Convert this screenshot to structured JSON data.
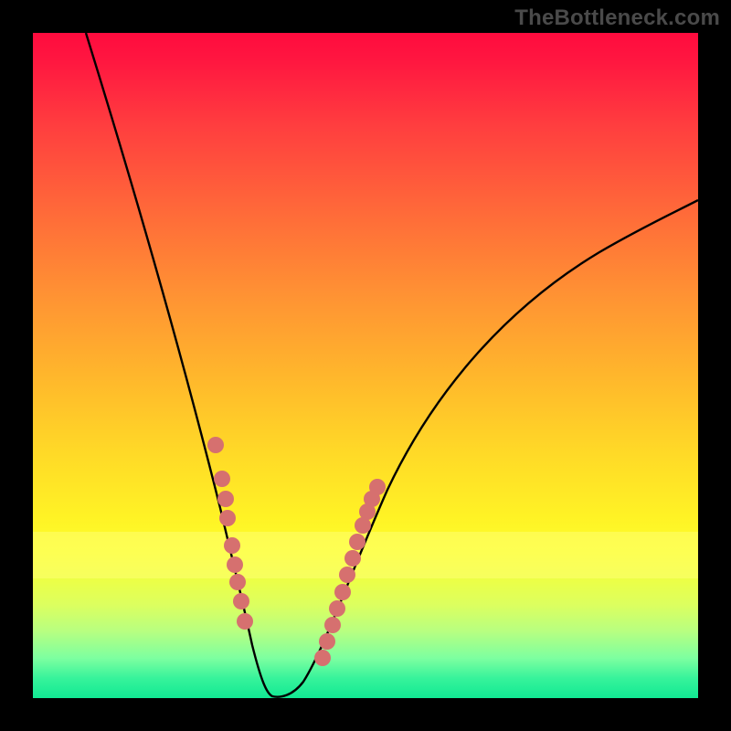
{
  "watermark": "TheBottleneck.com",
  "colors": {
    "curve_stroke": "#000000",
    "dot_fill": "#d6706f",
    "background": "#000000"
  },
  "chart_data": {
    "type": "line",
    "title": "",
    "xlabel": "",
    "ylabel": "",
    "xlim": [
      0,
      100
    ],
    "ylim": [
      0,
      100
    ],
    "grid": false,
    "series": [
      {
        "name": "curve",
        "x": [
          8,
          12,
          16,
          20,
          24,
          26,
          28,
          30,
          31,
          32,
          33,
          34,
          35,
          36,
          38,
          40,
          42,
          44,
          46,
          48,
          52,
          56,
          60,
          66,
          74,
          82,
          90,
          100
        ],
        "y": [
          100,
          88,
          76,
          64,
          50,
          42,
          34,
          24,
          18,
          12,
          7,
          3,
          0.5,
          0,
          0,
          0.5,
          3,
          8,
          14,
          20,
          30,
          38,
          44,
          52,
          60,
          66,
          71,
          76
        ],
        "note": "Approximate V-shaped bottleneck curve; y=0 near x≈36. Values estimated from pixel positions (no axis ticks present)."
      }
    ],
    "threshold_band": {
      "y_from": 18,
      "y_to": 25,
      "note": "pale yellow band"
    },
    "dots": {
      "name": "highlight-dots",
      "color": "#d6706f",
      "points_xy": [
        [
          27.5,
          38
        ],
        [
          28.5,
          33
        ],
        [
          29,
          30
        ],
        [
          29.3,
          27
        ],
        [
          30,
          23
        ],
        [
          30.4,
          20
        ],
        [
          30.8,
          17.5
        ],
        [
          31.3,
          14.5
        ],
        [
          31.8,
          11.5
        ],
        [
          43.5,
          6
        ],
        [
          44.2,
          8.5
        ],
        [
          45,
          11
        ],
        [
          45.8,
          13.5
        ],
        [
          46.5,
          16
        ],
        [
          47.3,
          18.5
        ],
        [
          48,
          21
        ],
        [
          48.8,
          23.5
        ],
        [
          49.6,
          26
        ],
        [
          50.3,
          28
        ],
        [
          51,
          30
        ],
        [
          51.8,
          31.8
        ]
      ],
      "note": "Two clusters of fat dots overlaying the curve on the descending and ascending flanks near the trough. Coordinates are in x%,y% of the plot area."
    }
  }
}
